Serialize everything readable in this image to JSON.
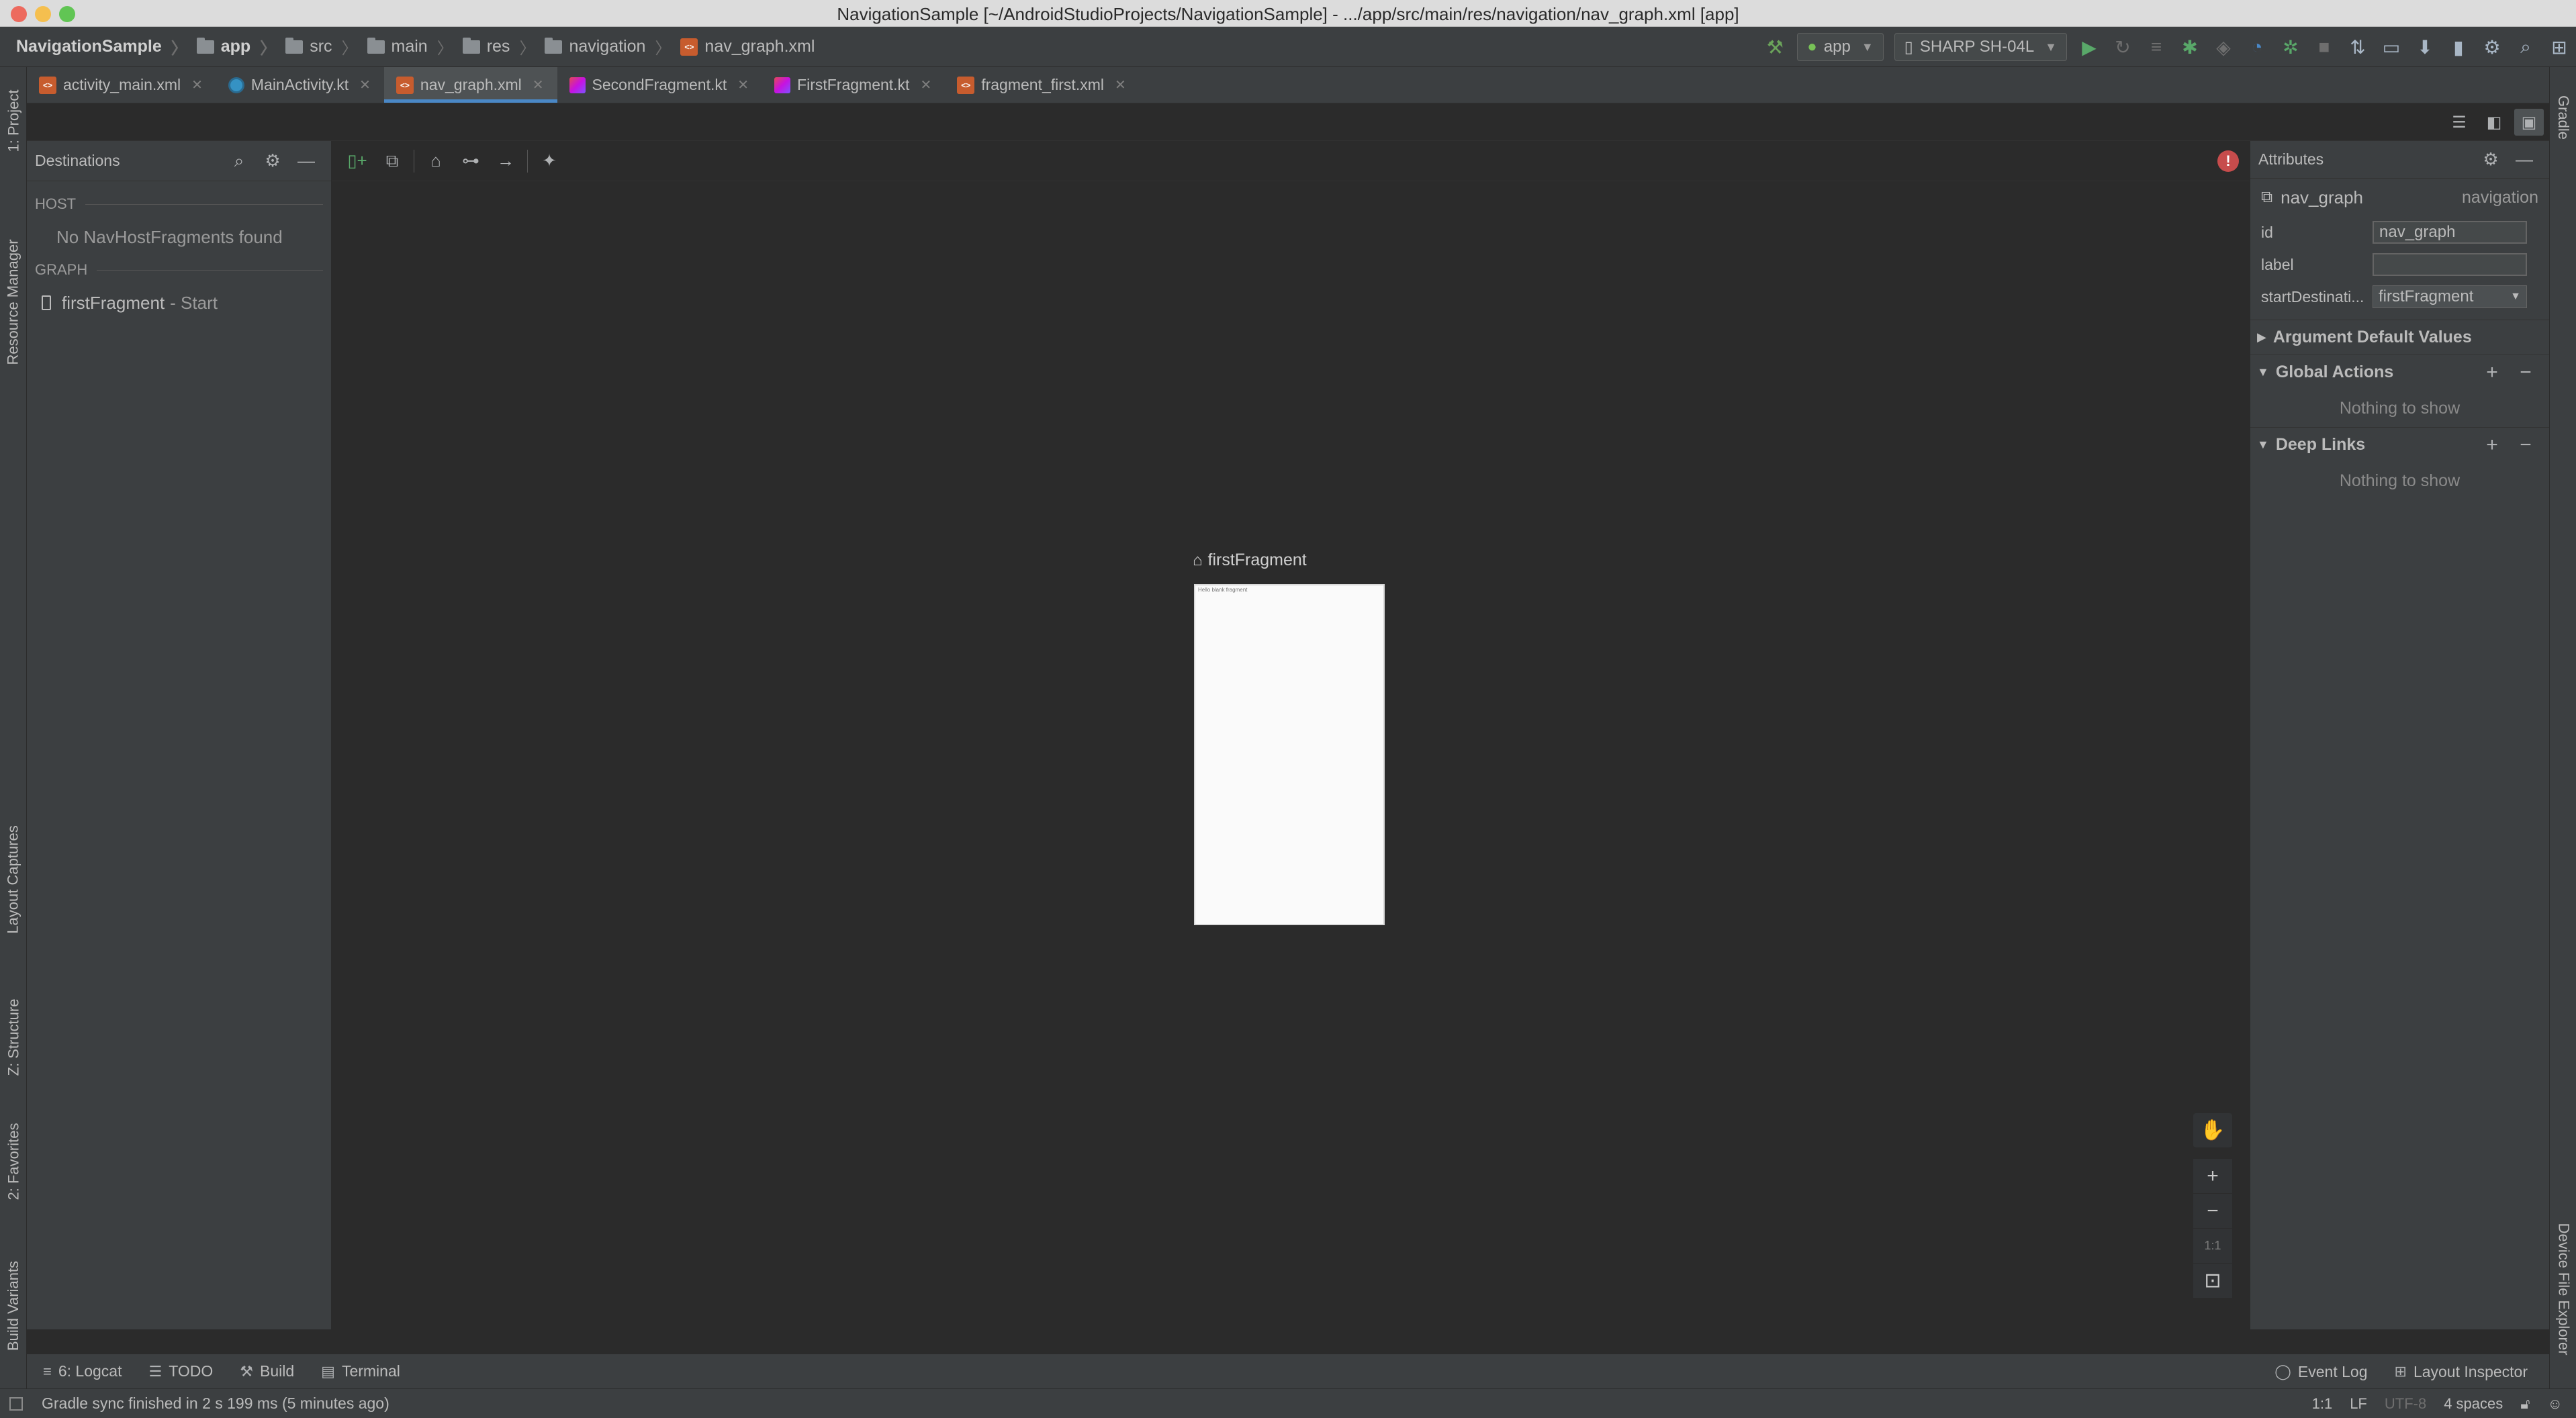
{
  "window": {
    "title": "NavigationSample [~/AndroidStudioProjects/NavigationSample] - .../app/src/main/res/navigation/nav_graph.xml [app]"
  },
  "breadcrumbs": [
    {
      "label": "NavigationSample"
    },
    {
      "label": "app"
    },
    {
      "label": "src"
    },
    {
      "label": "main"
    },
    {
      "label": "res"
    },
    {
      "label": "navigation"
    },
    {
      "label": "nav_graph.xml"
    }
  ],
  "toolbar": {
    "run_config": "app",
    "device": "SHARP SH-04L"
  },
  "tabs": [
    {
      "label": "activity_main.xml",
      "icon": "xml-file-icon"
    },
    {
      "label": "MainActivity.kt",
      "icon": "kotlin-class-icon"
    },
    {
      "label": "nav_graph.xml",
      "icon": "xml-file-icon",
      "active": true
    },
    {
      "label": "SecondFragment.kt",
      "icon": "kotlin-file-icon"
    },
    {
      "label": "FirstFragment.kt",
      "icon": "kotlin-file-icon"
    },
    {
      "label": "fragment_first.xml",
      "icon": "xml-file-icon"
    }
  ],
  "left_tool_windows": {
    "project": "1: Project",
    "resource_manager": "Resource Manager",
    "layout_captures": "Layout Captures",
    "structure": "Z: Structure",
    "favorites": "2: Favorites",
    "build_variants": "Build Variants"
  },
  "right_tool_windows": {
    "gradle": "Gradle",
    "device_file_explorer": "Device File Explorer"
  },
  "destinations": {
    "title": "Destinations",
    "host_header": "HOST",
    "host_empty": "No NavHostFragments found",
    "graph_header": "GRAPH",
    "items": [
      {
        "name": "firstFragment",
        "suffix": "- Start"
      }
    ]
  },
  "canvas": {
    "fragment_label": "firstFragment",
    "preview_text": "Hello blank fragment",
    "zoom_fit_label": "1:1"
  },
  "attributes": {
    "title": "Attributes",
    "component_name": "nav_graph",
    "component_type": "navigation",
    "fields": {
      "id_label": "id",
      "id_value": "nav_graph",
      "label_label": "label",
      "label_value": "",
      "start_label": "startDestinati...",
      "start_value": "firstFragment"
    },
    "sections": {
      "argument_defaults": "Argument Default Values",
      "global_actions": "Global Actions",
      "global_actions_empty": "Nothing to show",
      "deep_links": "Deep Links",
      "deep_links_empty": "Nothing to show"
    }
  },
  "bottom_tools": {
    "logcat": "6: Logcat",
    "todo": "TODO",
    "build": "Build",
    "terminal": "Terminal",
    "event_log": "Event Log",
    "layout_inspector": "Layout Inspector"
  },
  "status": {
    "message": "Gradle sync finished in 2 s 199 ms (5 minutes ago)",
    "position": "1:1",
    "line_sep": "LF",
    "encoding": "UTF-8",
    "indent": "4 spaces"
  },
  "colors": {
    "accent": "#4a88c7",
    "error": "#c74c4c",
    "background": "#2b2b2b",
    "panel": "#3c3f41"
  }
}
